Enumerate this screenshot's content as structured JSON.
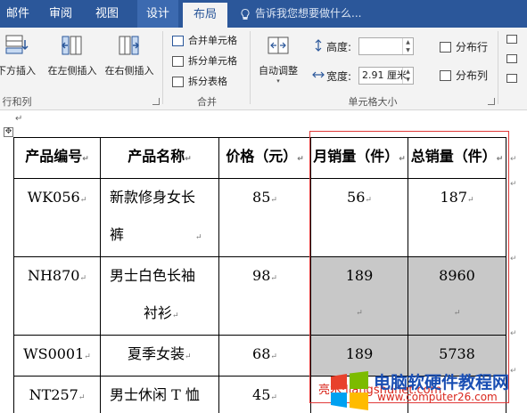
{
  "tabs": [
    {
      "label": "邮件",
      "active": false
    },
    {
      "label": "审阅",
      "active": false
    },
    {
      "label": "视图",
      "active": false
    },
    {
      "label": "设计",
      "active": false
    },
    {
      "label": "布局",
      "active": true
    }
  ],
  "tell_me": "告诉我您想要做什么...",
  "ribbon": {
    "rows_cols": {
      "insert_below": "下方插入",
      "insert_left": "在左侧插入",
      "insert_right": "在右侧插入",
      "group_label": "行和列"
    },
    "merge": {
      "merge_cells": "合并单元格",
      "split_cells": "拆分单元格",
      "split_table": "拆分表格",
      "group_label": "合并"
    },
    "cell_size": {
      "autofit": "自动调整",
      "height_label": "高度:",
      "height_value": "",
      "width_label": "宽度:",
      "width_value": "2.91 厘米",
      "distribute_rows": "分布行",
      "distribute_cols": "分布列",
      "group_label": "单元格大小"
    }
  },
  "table": {
    "headers": [
      "产品编号",
      "产品名称",
      "价格（元）",
      "月销量（件）",
      "总销量（件）"
    ],
    "rows": [
      {
        "id": "WK056",
        "name_line1": "新款修身女长",
        "name_line2": "裤",
        "price": "85",
        "monthly": "56",
        "total": "187",
        "highlight": false
      },
      {
        "id": "NH870",
        "name_line1": "男士白色长袖",
        "name_line2": "衬衫",
        "price": "98",
        "monthly": "189",
        "total": "8960",
        "highlight": true
      },
      {
        "id": "WS0001",
        "name_line1": "夏季女装",
        "name_line2": "",
        "price": "68",
        "monthly": "189",
        "total": "5738",
        "highlight": true
      },
      {
        "id": "NT257",
        "name_line1": "男士休闲 T 恤",
        "name_line2": "",
        "price": "45",
        "monthly": "",
        "total": "",
        "highlight": false
      }
    ]
  },
  "watermark": {
    "title": "电脑软硬件教程网",
    "url": "www.computer26.com",
    "overlay": "亮术·liangshunet.com"
  },
  "colors": {
    "ribbon_tab_bg": "#2b579a",
    "ribbon_body_bg": "#f3f3f3",
    "highlight_cell": "#c8c8c8",
    "selection_border": "#e03a3a",
    "watermark_blue": "#1a4fb3",
    "watermark_red": "#d9261c"
  }
}
